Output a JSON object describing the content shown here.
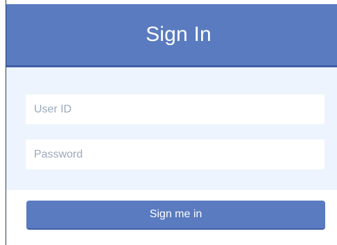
{
  "header": {
    "title": "Sign In"
  },
  "form": {
    "user_id": {
      "placeholder": "User ID",
      "value": ""
    },
    "password": {
      "placeholder": "Password",
      "value": ""
    },
    "submit_label": "Sign me in"
  },
  "colors": {
    "accent": "#5a7bbf",
    "accent_dark": "#3f5fa5",
    "panel_background": "#eef4fd",
    "placeholder_text": "#9aa8bd"
  }
}
